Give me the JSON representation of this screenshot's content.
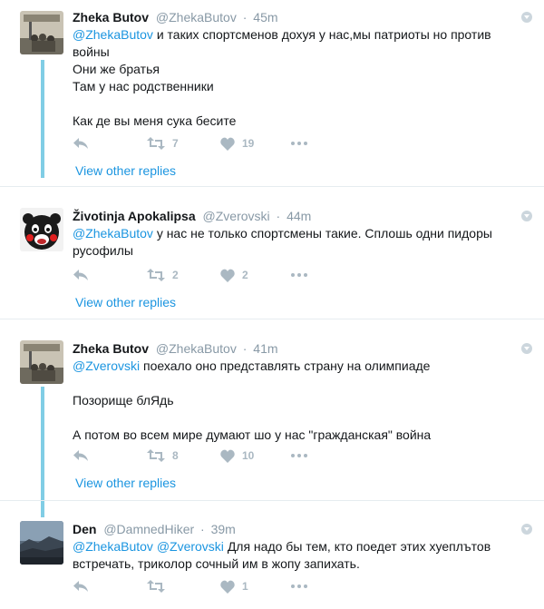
{
  "colors": {
    "accent": "#1b95e0",
    "thread_line": "#80cde5",
    "muted": "#8899a6",
    "icon": "#aab8c2"
  },
  "tweets": [
    {
      "name": "Zheka Butov",
      "handle": "@ZhekaButov",
      "separator": "·",
      "time": "45m",
      "mentions": [
        "@ZhekaButov"
      ],
      "lines": [
        "и таких спортсменов дохуя у нас,мы патриоты но против",
        "войны",
        "Они же братья",
        "Там у нас родственники",
        "",
        "Как де вы меня сука бесите"
      ],
      "retweets": "7",
      "likes": "19",
      "view_replies": "View other replies",
      "icons": [
        "reply-icon",
        "retweet-icon",
        "like-icon",
        "more-icon",
        "caret-down-icon"
      ]
    },
    {
      "name": "Životinja Apokalipsa",
      "handle": "@Zverovski",
      "separator": "·",
      "time": "44m",
      "mentions": [
        "@ZhekaButov"
      ],
      "lines": [
        "у нас не только спортсмены такие. Сплошь одни пидоры",
        "русофилы"
      ],
      "retweets": "2",
      "likes": "2",
      "view_replies": "View other replies",
      "icons": [
        "reply-icon",
        "retweet-icon",
        "like-icon",
        "more-icon",
        "caret-down-icon"
      ]
    },
    {
      "name": "Zheka Butov",
      "handle": "@ZhekaButov",
      "separator": "·",
      "time": "41m",
      "mentions": [
        "@Zverovski"
      ],
      "lines": [
        "поехало оно представлять страну на олимпиаде",
        "",
        "Позорище блЯдь",
        "",
        "А потом во всем мире думают шо у нас \"гражданская\" война"
      ],
      "retweets": "8",
      "likes": "10",
      "view_replies": "View other replies",
      "icons": [
        "reply-icon",
        "retweet-icon",
        "like-icon",
        "more-icon",
        "caret-down-icon"
      ]
    },
    {
      "name": "Den",
      "handle": "@DamnedHiker",
      "separator": "·",
      "time": "39m",
      "mentions": [
        "@ZhekaButov",
        "@Zverovski"
      ],
      "lines": [
        "Для надо бы тем, кто поедет этих хуеплътов",
        "встречать, триколор сочный им в жопу запихать."
      ],
      "retweets": "",
      "likes": "1",
      "icons": [
        "reply-icon",
        "retweet-icon",
        "like-icon",
        "more-icon",
        "caret-down-icon"
      ]
    }
  ]
}
